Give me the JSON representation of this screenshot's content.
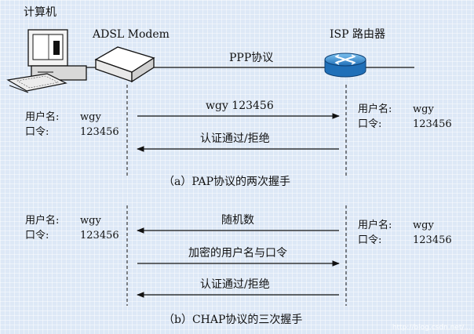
{
  "labels": {
    "computer": "计算机",
    "modem": "ADSL Modem",
    "router": "ISP 路由器",
    "ppp": "PPP协议"
  },
  "pap": {
    "caption": "（a）PAP协议的两次握手",
    "client": {
      "user_label": "用户名:",
      "user": "wgy",
      "pass_label": "口令:",
      "pass": "123456"
    },
    "server": {
      "user_label": "用户名:",
      "user": "wgy",
      "pass_label": "口令:",
      "pass": "123456"
    },
    "msg1": "wgy 123456",
    "msg2": "认证通过/拒绝"
  },
  "chap": {
    "caption": "（b）CHAP协议的三次握手",
    "client": {
      "user_label": "用户名:",
      "user": "wgy",
      "pass_label": "口令:",
      "pass": "123456"
    },
    "server": {
      "user_label": "用户名:",
      "user": "wgy",
      "pass_label": "口令:",
      "pass": "123456"
    },
    "msg1": "随机数",
    "msg2": "加密的用户名与口令",
    "msg3": "认证通过/拒绝"
  },
  "watermark": "http://blog.csdn.net/..."
}
